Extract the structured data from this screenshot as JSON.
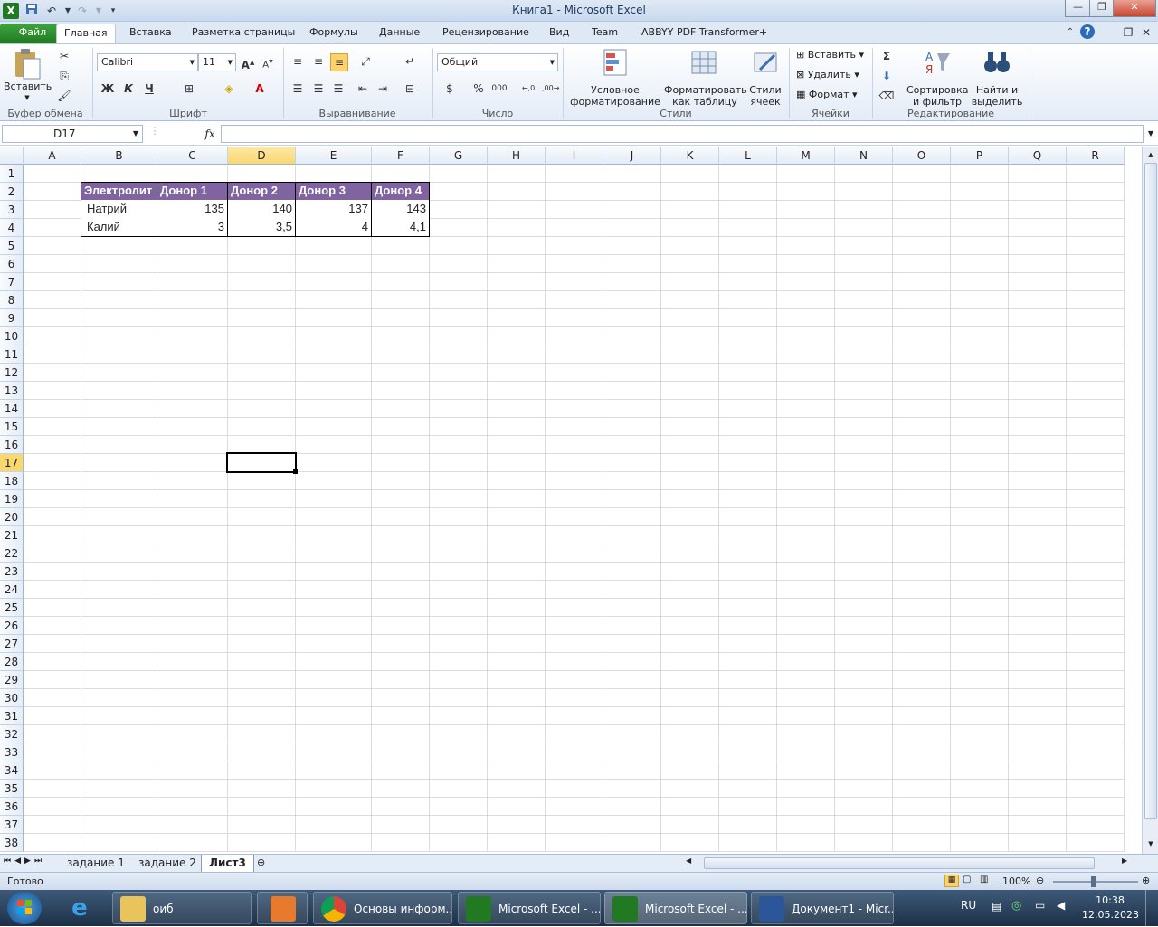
{
  "window": {
    "title": "Книга1  -  Microsoft Excel"
  },
  "tabs": [
    {
      "label": "Файл"
    },
    {
      "label": "Главная"
    },
    {
      "label": "Вставка"
    },
    {
      "label": "Разметка страницы"
    },
    {
      "label": "Формулы"
    },
    {
      "label": "Данные"
    },
    {
      "label": "Рецензирование"
    },
    {
      "label": "Вид"
    },
    {
      "label": "Team"
    },
    {
      "label": "ABBYY PDF Transformer+"
    }
  ],
  "ribbon": {
    "clipboard": {
      "paste": "Вставить",
      "label": "Буфер обмена"
    },
    "font": {
      "name": "Calibri",
      "size": "11",
      "bold": "Ж",
      "italic": "К",
      "underline": "Ч",
      "label": "Шрифт"
    },
    "alignment": {
      "label": "Выравнивание"
    },
    "number": {
      "format": "Общий",
      "label": "Число"
    },
    "styles": {
      "conditional": "Условное",
      "conditional2": "форматирование",
      "format_table": "Форматировать",
      "format_table2": "как таблицу",
      "cell_styles": "Стили",
      "cell_styles2": "ячеек",
      "label": "Стили"
    },
    "cells": {
      "insert": "Вставить",
      "delete": "Удалить",
      "format": "Формат",
      "label": "Ячейки"
    },
    "editing": {
      "sort": "Сортировка",
      "sort2": "и фильтр",
      "find": "Найти и",
      "find2": "выделить",
      "label": "Редактирование"
    }
  },
  "formula_bar": {
    "name_box": "D17",
    "fx": "fx",
    "formula": ""
  },
  "columns": [
    "A",
    "B",
    "C",
    "D",
    "E",
    "F",
    "G",
    "H",
    "I",
    "J",
    "K",
    "L",
    "M",
    "N",
    "O",
    "P",
    "Q",
    "R"
  ],
  "selected_column": "D",
  "selected_row": "17",
  "table": {
    "headers": [
      "Электролит",
      "Донор 1",
      "Донор 2",
      "Донор 3",
      "Донор 4"
    ],
    "rows": [
      [
        "Натрий",
        "135",
        "140",
        "137",
        "143"
      ],
      [
        "Калий",
        "3",
        "3,5",
        "4",
        "4,1"
      ]
    ]
  },
  "sheets": [
    {
      "label": "задание 1"
    },
    {
      "label": "задание 2"
    },
    {
      "label": "Лист3"
    }
  ],
  "status": {
    "ready": "Готово",
    "zoom": "100%"
  },
  "taskbar": {
    "items": [
      {
        "label": "оиб"
      },
      {
        "label": ""
      },
      {
        "label": "Основы информ..."
      },
      {
        "label": "Microsoft Excel - ..."
      },
      {
        "label": "Microsoft Excel - ..."
      },
      {
        "label": "Документ1 - Micr..."
      }
    ],
    "lang": "RU",
    "time": "10:38",
    "date": "12.05.2023"
  },
  "colors": {
    "header_fill": "#8064a2",
    "file_tab": "#2a8a2a",
    "selection_highlight": "#f9d86d"
  }
}
